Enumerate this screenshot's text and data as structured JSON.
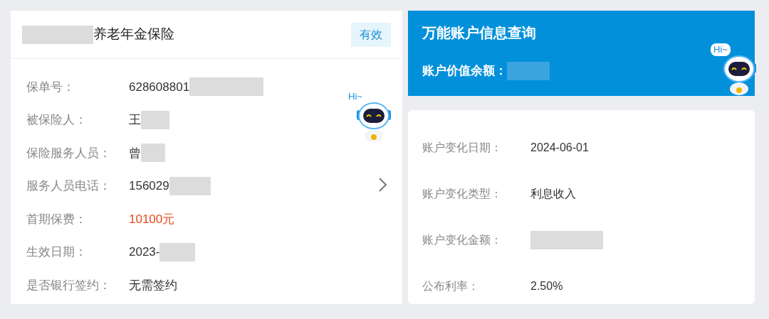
{
  "policy": {
    "title": "养老年金保险",
    "title_redacted": true,
    "status": "有效",
    "fields": [
      {
        "label": "保单号：",
        "value": "628608801",
        "redacted": true,
        "kind": "plain"
      },
      {
        "label": "被保险人：",
        "value": "王",
        "redacted": true,
        "kind": "plain"
      },
      {
        "label": "保险服务人员：",
        "value": "曾",
        "redacted": true,
        "kind": "plain"
      },
      {
        "label": "服务人员电话：",
        "value": "156029",
        "redacted": true,
        "kind": "plain"
      },
      {
        "label": "首期保费：",
        "value": "10100元",
        "redacted": false,
        "kind": "highlight"
      },
      {
        "label": "生效日期：",
        "value": "2023-",
        "redacted": true,
        "kind": "plain"
      },
      {
        "label": "是否银行签约：",
        "value": "无需签约",
        "redacted": false,
        "kind": "plain"
      }
    ],
    "assistant": {
      "greeting": "Hi~"
    }
  },
  "account": {
    "title": "万能账户信息查询",
    "balance_label": "账户价值余额：",
    "balance_redacted": true,
    "assistant": {
      "greeting": "Hi~"
    },
    "fields": [
      {
        "label": "账户变化日期：",
        "value": "2024-06-01",
        "redacted": false
      },
      {
        "label": "账户变化类型：",
        "value": "利息收入",
        "redacted": false
      },
      {
        "label": "账户变化金额：",
        "redacted": true
      },
      {
        "label": "公布利率：",
        "value": "2.50%",
        "redacted": false
      }
    ]
  }
}
